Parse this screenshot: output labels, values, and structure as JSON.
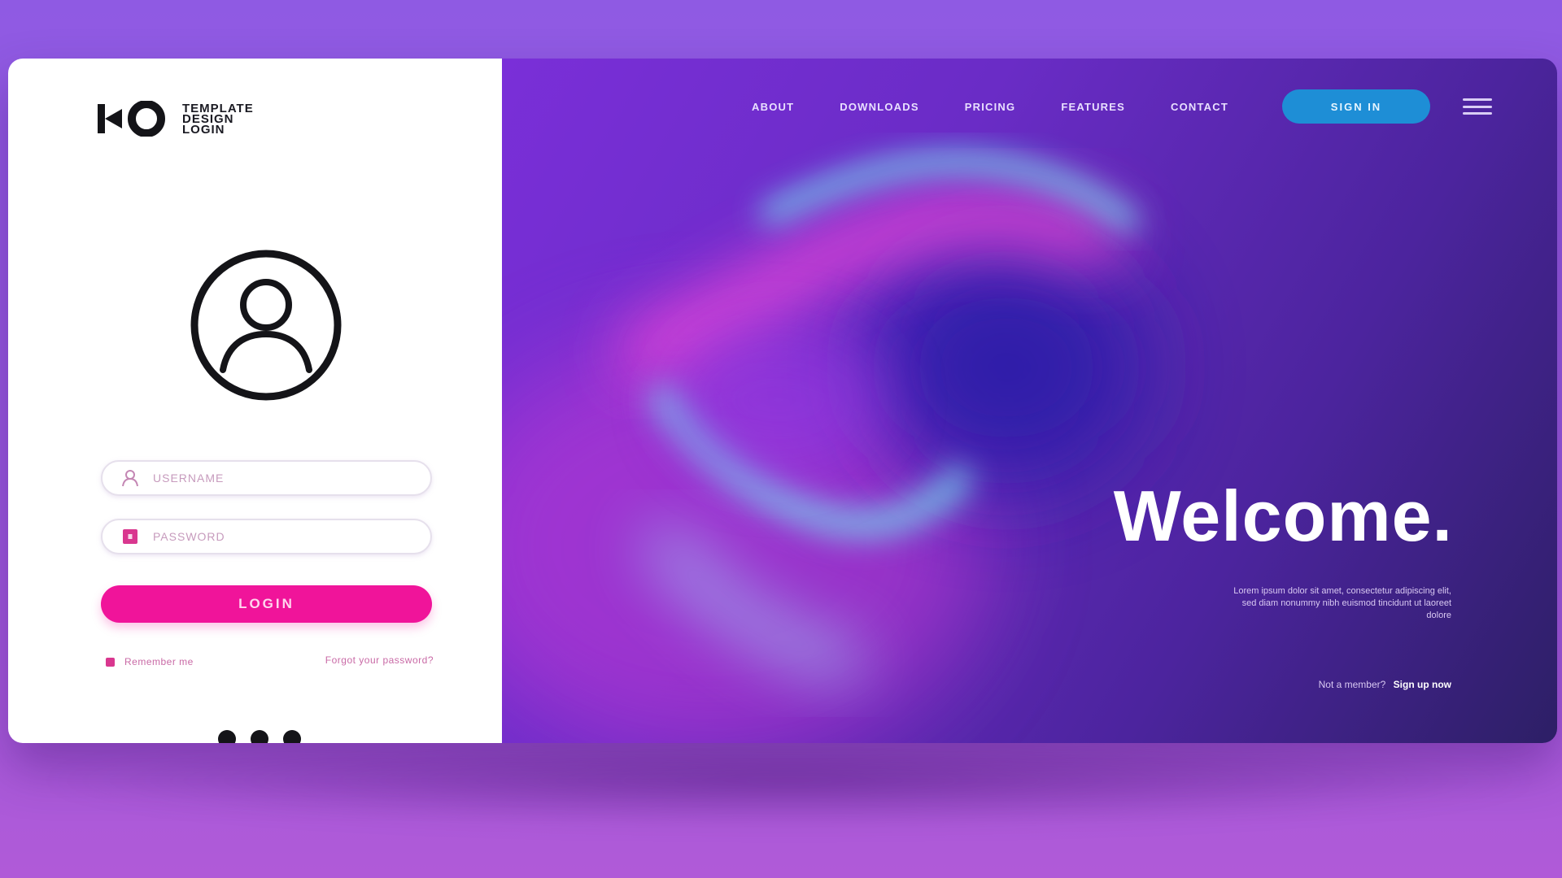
{
  "brand": {
    "line1": "TEMPLATE",
    "line2": "DESIGN",
    "line3": "LOGIN",
    "logo_icon": "io-logo-icon"
  },
  "login_form": {
    "username_placeholder": "USERNAME",
    "password_placeholder": "PASSWORD",
    "username_icon": "user-icon",
    "password_icon": "lock-icon",
    "login_label": "LOGIN",
    "remember_label": "Remember me",
    "forgot_label": "Forgot your password?"
  },
  "nav": {
    "items": [
      "ABOUT",
      "DOWNLOADS",
      "PRICING",
      "FEATURES",
      "CONTACT"
    ],
    "signin_label": "SIGN IN",
    "menu_icon": "hamburger-icon"
  },
  "hero": {
    "title": "Welcome.",
    "description": "Lorem ipsum dolor sit amet, consectetur adipiscing elit, sed diam nonummy nibh euismod tincidunt ut laoreet dolore",
    "signup_prompt": "Not a member?",
    "signup_link": "Sign up now"
  },
  "colors": {
    "accent_pink": "#f0149a",
    "signin_blue": "#1e8ed6",
    "background_purple": "#8f5ae3"
  }
}
